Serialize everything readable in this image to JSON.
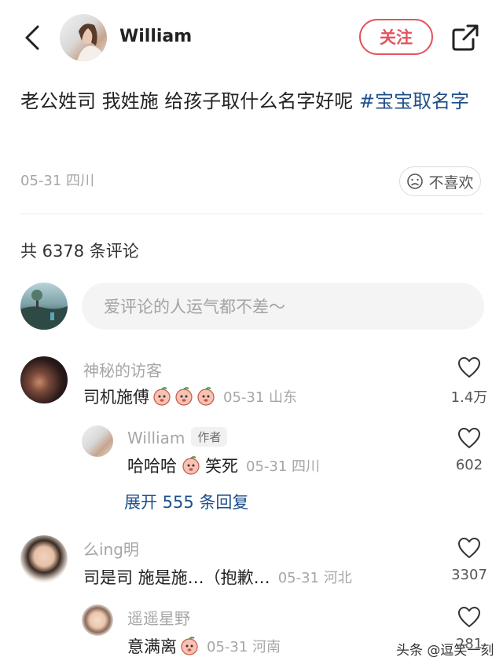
{
  "header": {
    "author_name": "William",
    "follow_label": "关注"
  },
  "post": {
    "text": "老公姓司 我姓施 给孩子取什么名字好呢 ",
    "hashtag": "#宝宝取名字",
    "meta": "05-31 四川",
    "dislike_label": "不喜欢"
  },
  "comments_header": {
    "count_text": "共 6378 条评论",
    "input_placeholder": "爱评论的人运气都不差～"
  },
  "comments": [
    {
      "name": "神秘的访客",
      "text": "司机施傅",
      "meta": "05-31 山东",
      "likes": "1.4万",
      "emoji_count": 3
    },
    {
      "name": "William",
      "badge": "作者",
      "text_before": "哈哈哈",
      "text_after": "笑死",
      "meta": "05-31 四川",
      "likes": "602",
      "expand_text": "展开 555 条回复"
    },
    {
      "name": "么ing明",
      "text": "司是司 施是施…（抱歉…",
      "meta": "05-31 河北",
      "likes": "3307"
    },
    {
      "name": "遥遥星野",
      "text": "意满离",
      "meta": "05-31 河南",
      "likes": "281"
    }
  ],
  "watermark": "头条 @逗笑一刻",
  "colors": {
    "accent_red": "#e5535d",
    "link_blue": "#1f4f8a",
    "meta_gray": "#a6a6a6"
  }
}
